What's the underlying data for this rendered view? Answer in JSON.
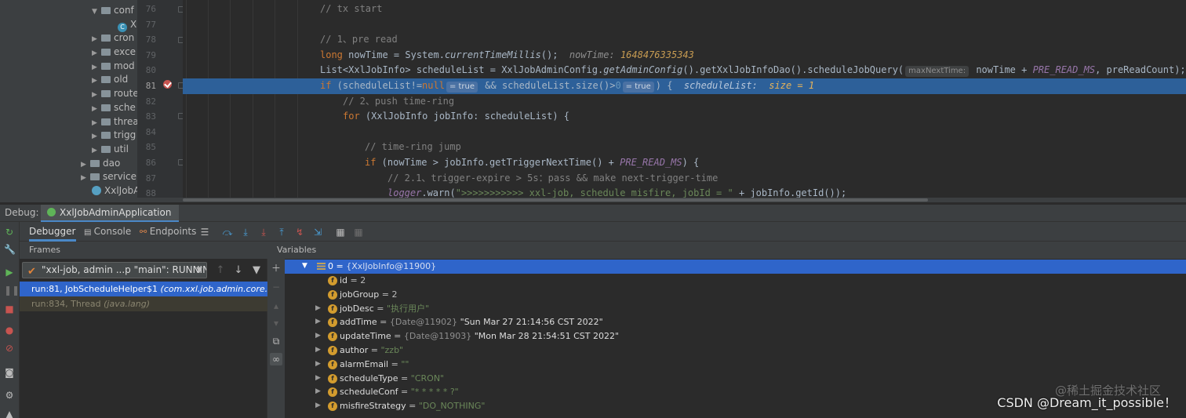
{
  "colors": {
    "editor_bg": "#2b2b2b",
    "panel_bg": "#3c3f41",
    "highlight_line": "#2d6099",
    "selection": "#2f65ca",
    "keyword": "#cc7832",
    "comment": "#808080",
    "string": "#6a8759",
    "constant": "#9876aa",
    "inline_value": "#c69b52",
    "breakpoint": "#c75450"
  },
  "project_tree": {
    "items": [
      {
        "label": "conf",
        "expanded": true,
        "icon": "folder-icon"
      },
      {
        "label": "X",
        "icon": "class-icon"
      },
      {
        "label": "cron",
        "icon": "folder-icon"
      },
      {
        "label": "exce",
        "icon": "folder-icon"
      },
      {
        "label": "mod",
        "icon": "folder-icon"
      },
      {
        "label": "old",
        "icon": "folder-icon"
      },
      {
        "label": "route",
        "icon": "folder-icon"
      },
      {
        "label": "sche",
        "icon": "folder-icon"
      },
      {
        "label": "threa",
        "icon": "folder-icon"
      },
      {
        "label": "trigg",
        "icon": "folder-icon"
      },
      {
        "label": "util",
        "icon": "folder-icon"
      },
      {
        "label": "dao",
        "icon": "folder-icon"
      },
      {
        "label": "service",
        "icon": "folder-icon"
      },
      {
        "label": "XxlJobA",
        "icon": "spring-boot-icon"
      }
    ]
  },
  "editor": {
    "line_numbers": [
      "76",
      "77",
      "78",
      "79",
      "80",
      "81",
      "82",
      "83",
      "84",
      "85",
      "86",
      "87",
      "88"
    ],
    "current_line": "81",
    "code": {
      "l76_comment": "// tx start",
      "l78_comment": "// 1、pre read",
      "l79_kw": "long",
      "l79_a": " nowTime = System.",
      "l79_fn": "currentTimeMillis",
      "l79_b": "();",
      "l79_hint_name": "nowTime: ",
      "l79_hint_value": "1648476335343",
      "l80_a": "List<XxlJobInfo> scheduleList = XxlJobAdminConfig.",
      "l80_fn": "getAdminConfig",
      "l80_b": "().getXxlJobInfoDao().scheduleJobQuery(",
      "l80_chip": "maxNextTime:",
      "l80_c": " nowTime + ",
      "l80_const": "PRE_READ_MS",
      "l80_d": ", preReadCount);",
      "l80_tail": "p",
      "l81_kw": "if",
      "l81_a": " (scheduleList!=",
      "l81_null": "null",
      "l81_chip1": "= true",
      "l81_b": " && scheduleList.size()>",
      "l81_zero": "0",
      "l81_chip2": "= true",
      "l81_c": ") {",
      "l81_hint_name": "scheduleList:  ",
      "l81_hint_value": "size = 1",
      "l82_comment": "// 2、push time-ring",
      "l83_kw": "for",
      "l83_a": " (XxlJobInfo jobInfo: scheduleList) {",
      "l85_comment": "// time-ring jump",
      "l86_kw": "if",
      "l86_a": " (nowTime > jobInfo.getTriggerNextTime() + ",
      "l86_const": "PRE_READ_MS",
      "l86_b": ") {",
      "l87_comment": "// 2.1、trigger-expire > 5s：pass && make next-trigger-time",
      "l88_log": "logger",
      "l88_a": ".warn(",
      "l88_str": "\">>>>>>>>>>> xxl-job, schedule misfire, jobId = \"",
      "l88_b": " + jobInfo.getId());"
    }
  },
  "debug": {
    "title": "Debug:",
    "run_config": "XxlJobAdminApplication",
    "tabs": {
      "debugger": "Debugger",
      "console": "Console",
      "endpoints": "Endpoints"
    },
    "frames_header": "Frames",
    "variables_header": "Variables",
    "thread_selector": "\"xxl-job, admin ...p \"main\": RUNNING",
    "frames": [
      {
        "method": "run:81, JobScheduleHelper$1 ",
        "pkg": "(com.xxl.job.admin.core.thread)",
        "selected": true
      },
      {
        "method": "run:834, Thread ",
        "pkg": "(java.lang)",
        "selected": false
      }
    ],
    "variables": {
      "root": {
        "name": "0",
        "value": "{XxlJobInfo@11900}"
      },
      "fields": [
        {
          "name": "id",
          "eq": " = ",
          "ref": "",
          "value": "2",
          "type": "num",
          "expandable": false
        },
        {
          "name": "jobGroup",
          "eq": " = ",
          "ref": "",
          "value": "2",
          "type": "num",
          "expandable": false
        },
        {
          "name": "jobDesc",
          "eq": " = ",
          "ref": "",
          "value": "\"执行用户\"",
          "type": "str",
          "expandable": true
        },
        {
          "name": "addTime",
          "eq": " = ",
          "ref": "{Date@11902} ",
          "value": "\"Sun Mar 27 21:14:56 CST 2022\"",
          "type": "plain",
          "expandable": true
        },
        {
          "name": "updateTime",
          "eq": " = ",
          "ref": "{Date@11903} ",
          "value": "\"Mon Mar 28 21:54:51 CST 2022\"",
          "type": "plain",
          "expandable": true
        },
        {
          "name": "author",
          "eq": " = ",
          "ref": "",
          "value": "\"zzb\"",
          "type": "str",
          "expandable": true
        },
        {
          "name": "alarmEmail",
          "eq": " = ",
          "ref": "",
          "value": "\"\"",
          "type": "str",
          "expandable": true
        },
        {
          "name": "scheduleType",
          "eq": " = ",
          "ref": "",
          "value": "\"CRON\"",
          "type": "str",
          "expandable": true
        },
        {
          "name": "scheduleConf",
          "eq": " = ",
          "ref": "",
          "value": "\"* * * * * ?\"",
          "type": "str",
          "expandable": true
        },
        {
          "name": "misfireStrategy",
          "eq": " = ",
          "ref": "",
          "value": "\"DO_NOTHING\"",
          "type": "str",
          "expandable": true
        }
      ]
    }
  },
  "watermark": "CSDN @Dream_it_possible！",
  "watermark_faint": "@稀土掘金技术社区"
}
